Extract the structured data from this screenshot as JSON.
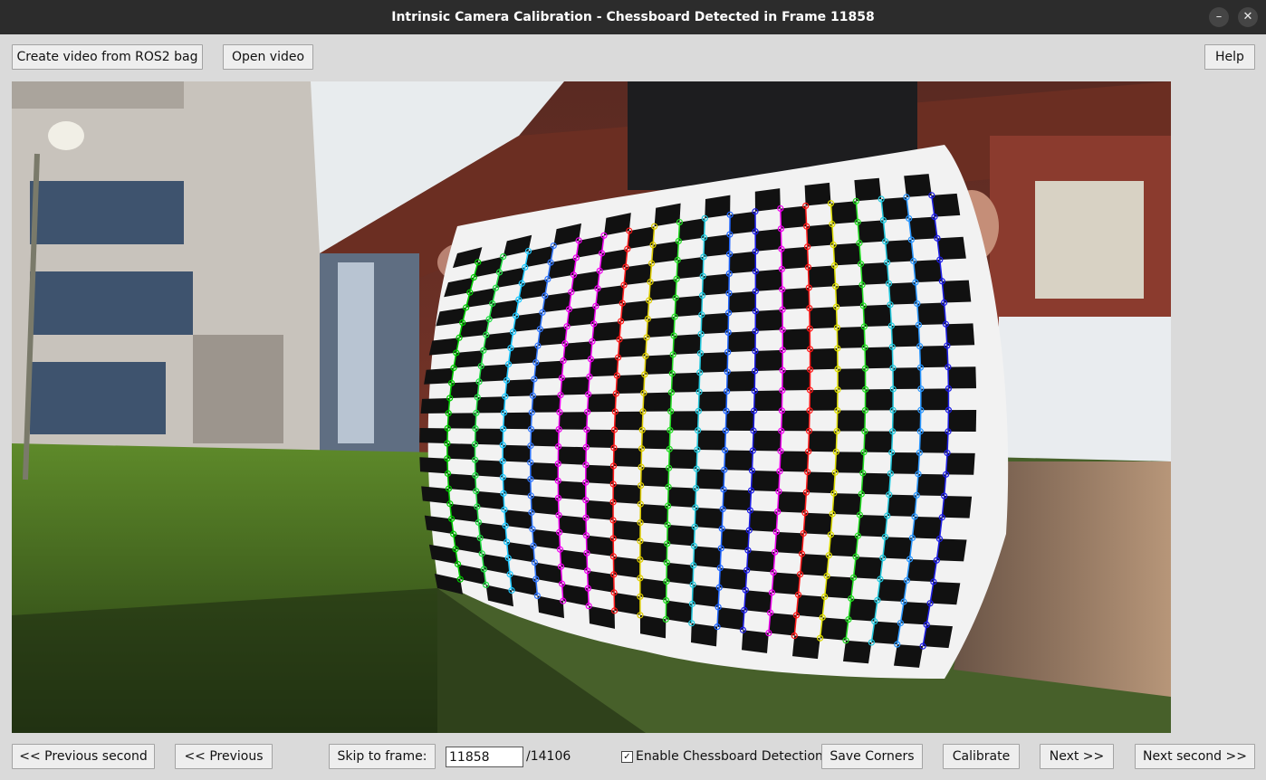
{
  "window": {
    "title": "Intrinsic Camera Calibration - Chessboard Detected in Frame 11858",
    "minimize_glyph": "–",
    "close_glyph": "✕"
  },
  "toolbar": {
    "create_video_label": "Create video from ROS2 bag",
    "open_video_label": "Open video",
    "help_label": "Help"
  },
  "navigation": {
    "previous_second_label": "<< Previous second",
    "previous_label": "<< Previous",
    "skip_label": "Skip to frame:",
    "frame_value": "11858",
    "total_frames": "/14106",
    "detection_label": "Enable Chessboard Detection",
    "detection_checked": true,
    "save_corners_label": "Save Corners",
    "calibrate_label": "Calibrate",
    "next_label": "Next >>",
    "next_second_label": "Next second >>"
  },
  "colors": {
    "corner_columns": [
      "#00cc00",
      "#22dd44",
      "#1ec8ff",
      "#3278ff",
      "#ee00ee",
      "#ee00ee",
      "#ff1a1a",
      "#ddcc00",
      "#22dd22",
      "#22c8dd",
      "#1e64ff",
      "#1e1ee6",
      "#ee00ee",
      "#ff1a1a",
      "#dddd00",
      "#22dd22",
      "#22c8dd",
      "#2896ff",
      "#1e1ee6"
    ]
  }
}
